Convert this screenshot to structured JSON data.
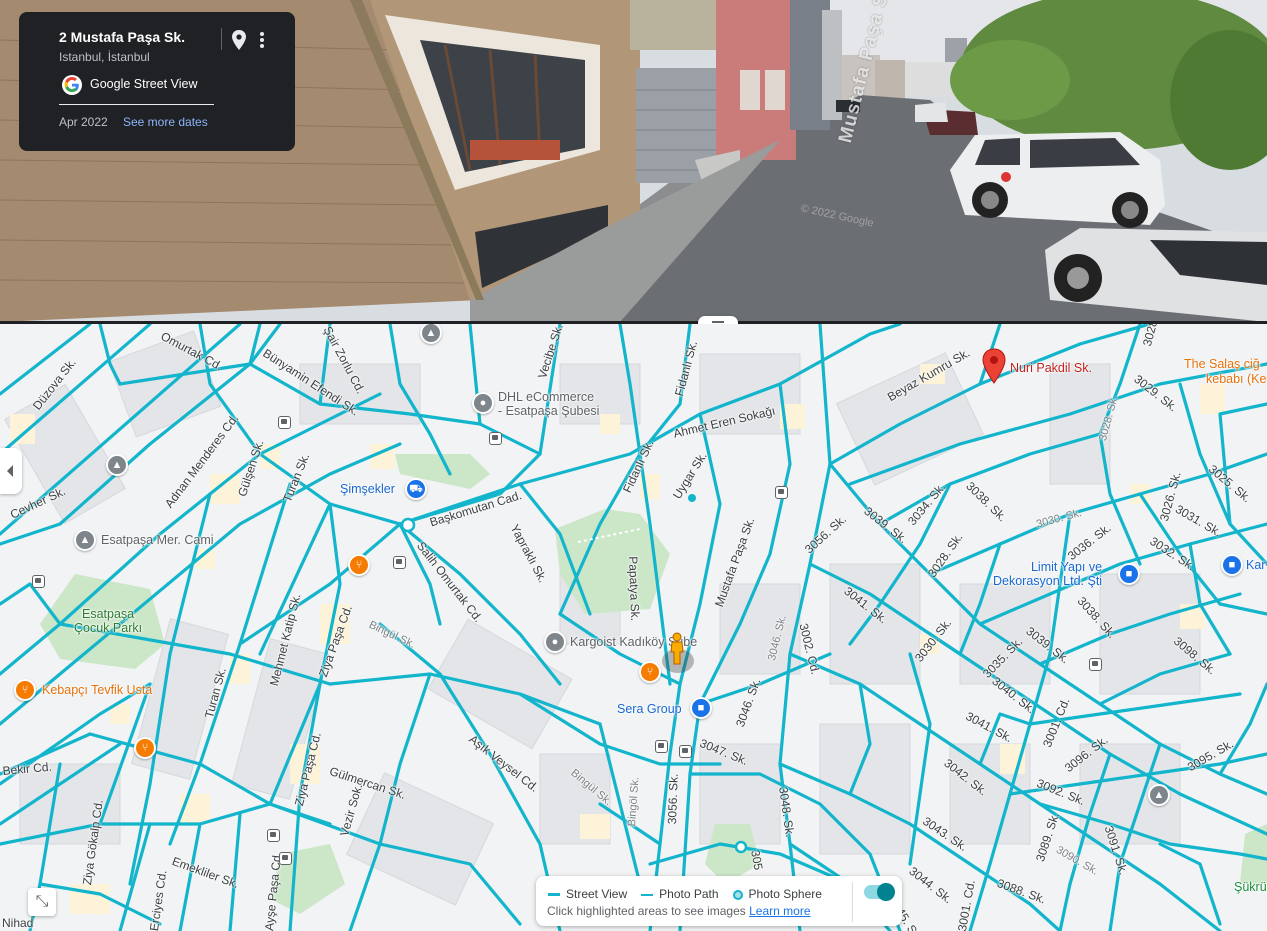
{
  "card": {
    "address": "2 Mustafa Paşa Sk.",
    "city": "Istanbul, İstanbul",
    "service": "Google Street View",
    "date": "Apr 2022",
    "see_more": "See more dates",
    "pin_icon": "location-pin-icon",
    "menu_icon": "more-vert-icon"
  },
  "panorama": {
    "street_sign": "Mustafa Paşa Sk.",
    "watermark": "© 2022 Google"
  },
  "colors": {
    "coverage": "#12b5cb",
    "card_bg": "#202124",
    "link": "#8ab4f8"
  },
  "map": {
    "streets": [
      {
        "text": "Düzova Sk."
      },
      {
        "text": "Omurtak Cd."
      },
      {
        "text": "Bünyamin Efendi Sk."
      },
      {
        "text": "Şair Zorlu Cd."
      },
      {
        "text": "Vecibe Sk."
      },
      {
        "text": "Fidanlı Sk."
      },
      {
        "text": "Ahmet Eren Sokağı"
      },
      {
        "text": "Beyaz Kumru Sk."
      },
      {
        "text": "Adnan Menderes Cd."
      },
      {
        "text": "Gülşen Sk."
      },
      {
        "text": "Turan Sk."
      },
      {
        "text": "Cevher Sk."
      },
      {
        "text": "Başkomutan Cad."
      },
      {
        "text": "Uygar Sk."
      },
      {
        "text": "Fidanlı Sk."
      },
      {
        "text": "Yapraklı Sk."
      },
      {
        "text": "Salih Omurtak Cd."
      },
      {
        "text": "Papatya Sk."
      },
      {
        "text": "Mustafa Paşa Sk."
      },
      {
        "text": "3056. Sk."
      },
      {
        "text": "3039. Sk."
      },
      {
        "text": "3034. Sk."
      },
      {
        "text": "3038. Sk."
      },
      {
        "text": "3036. Sk."
      },
      {
        "text": "3030. Sk."
      },
      {
        "text": "3029. Sk."
      },
      {
        "text": "3028. Sk."
      },
      {
        "text": "3025. Sk."
      },
      {
        "text": "3026. Sk."
      },
      {
        "text": "3031. Sk."
      },
      {
        "text": "3032. Sk."
      },
      {
        "text": "3028. Sk."
      },
      {
        "text": "3041. Sk."
      },
      {
        "text": "3046. Sk."
      },
      {
        "text": "3002. Cd."
      },
      {
        "text": "3030. Sk."
      },
      {
        "text": "3035. Sk."
      },
      {
        "text": "3039. Sk."
      },
      {
        "text": "3038. Sk."
      },
      {
        "text": "3040. Sk."
      },
      {
        "text": "3041. Sk."
      },
      {
        "text": "3098. Sk."
      },
      {
        "text": "Mehmet Katip Sk."
      },
      {
        "text": "Ziya Paşa Cd."
      },
      {
        "text": "Bingül Sk."
      },
      {
        "text": "Turan Sk."
      },
      {
        "text": "3046. Sk."
      },
      {
        "text": "3047. Sk."
      },
      {
        "text": "Aşık Veysel Cd."
      },
      {
        "text": "Bingül Sk."
      },
      {
        "text": "Ziya Paşa Cd."
      },
      {
        "text": "Gülmercan Sk."
      },
      {
        "text": "Vezir Sok."
      },
      {
        "text": "Bekir Cd."
      },
      {
        "text": "Ziya Gökalp Cd."
      },
      {
        "text": "3056. Sk."
      },
      {
        "text": "Bingöl Sk."
      },
      {
        "text": "3048. Sk."
      },
      {
        "text": "3042. Sk."
      },
      {
        "text": "3001. Cd."
      },
      {
        "text": "3096. Sk."
      },
      {
        "text": "3092. Sk."
      },
      {
        "text": "3095. Sk."
      },
      {
        "text": "3043. Sk."
      },
      {
        "text": "3089. Sk."
      },
      {
        "text": "3090. Sk."
      },
      {
        "text": "3091. Sk."
      },
      {
        "text": "3044. Sk."
      },
      {
        "text": "3088. Sk."
      },
      {
        "text": "Emekliler Sk."
      },
      {
        "text": "Ayşe Paşa Cd."
      },
      {
        "text": "Erciyes Cd."
      },
      {
        "text": "3045. Sk."
      },
      {
        "text": "3001. Cd."
      },
      {
        "text": "Nihad"
      },
      {
        "text": "305"
      },
      {
        "text": "3028"
      }
    ],
    "pois": [
      {
        "name": "DHL eCommerce",
        "name2": "- Esatpaşa Şubesi"
      },
      {
        "name": "Şimşekler"
      },
      {
        "name": "Esatpaşa Mer. Cami"
      },
      {
        "name": "Esatpaşa",
        "name2": "Çocuk Parkı"
      },
      {
        "name": "Kebapçı Tevfik Usta"
      },
      {
        "name": "Kargoist Kadıköy Şube"
      },
      {
        "name": "Sera Group"
      },
      {
        "name": "Nuri Pakdil Sk."
      },
      {
        "name": "The Salaş ciğ",
        "name2": "kebabı (Ke"
      },
      {
        "name": "Limit Yapı ve",
        "name2": "Dekorasyon Ltd. Şti"
      },
      {
        "name": "Kar"
      },
      {
        "name": "Şükrü"
      }
    ],
    "expand_icon": "collapse-map-icon",
    "sidebar_toggle_icon": "chevron-left-icon"
  },
  "legend": {
    "street_view": "Street View",
    "photo_path": "Photo Path",
    "photo_sphere": "Photo Sphere",
    "hint": "Click highlighted areas to see images",
    "learn_more": "Learn more"
  }
}
